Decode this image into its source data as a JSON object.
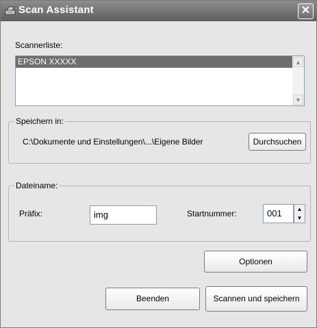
{
  "window": {
    "title": "Scan Assistant",
    "close_symbol": "✕"
  },
  "scanner_list": {
    "label": "Scannerliste:",
    "items": [
      "EPSON XXXXX"
    ],
    "selected_index": 0
  },
  "save_in": {
    "legend": "Speichern in:",
    "path": "C:\\Dokumente und Einstellungen\\...\\Eigene Bilder",
    "browse_label": "Durchsuchen"
  },
  "filename": {
    "legend": "Dateiname:",
    "prefix_label": "Präfix:",
    "prefix_value": "img",
    "start_label": "Startnummer:",
    "start_value": "001"
  },
  "buttons": {
    "options": "Optionen",
    "quit": "Beenden",
    "scan_save": "Scannen und speichern"
  },
  "icons": {
    "title": "scanner-icon",
    "close": "close-icon",
    "scroll_up": "chevron-up-icon",
    "scroll_down": "chevron-down-icon",
    "spin_up": "triangle-up-icon",
    "spin_down": "triangle-down-icon"
  }
}
